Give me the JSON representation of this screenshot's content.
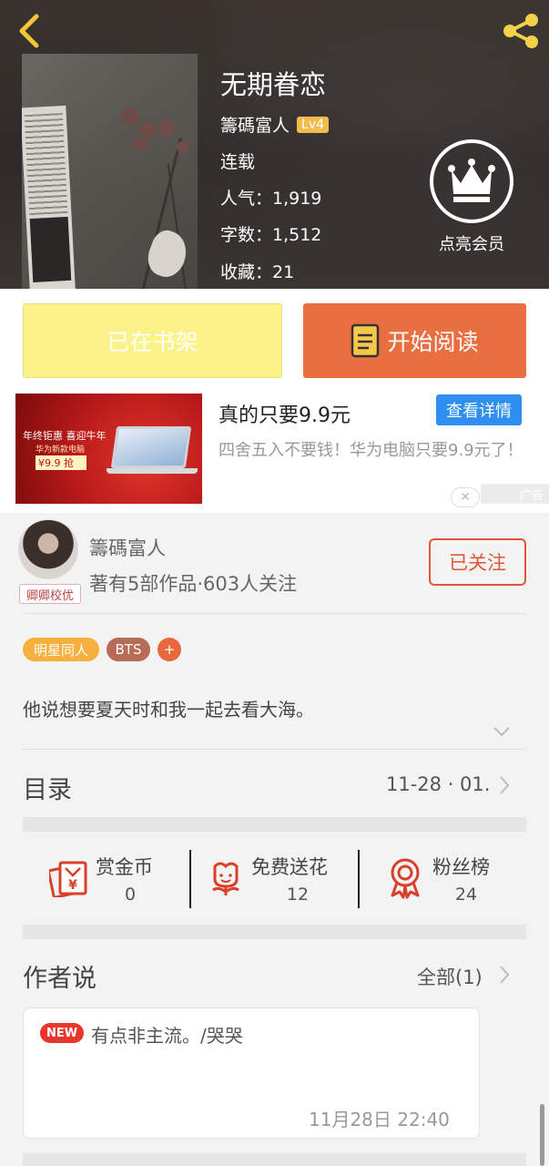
{
  "header": {
    "back_icon": "back-chevron-icon",
    "share_icon": "share-icon",
    "cover_icon": "book-cover-image"
  },
  "book": {
    "title": "无期眷恋",
    "author": "籌碼富人",
    "level": "Lv4",
    "status": "连载",
    "popularity": "人气：1,919",
    "word_count": "字数：1,512",
    "favorites": "收藏：21"
  },
  "vip": {
    "label": "点亮会员",
    "icon": "crown-icon"
  },
  "actions": {
    "shelf_label": "已在书架",
    "read_label": "开始阅读",
    "read_icon": "book-icon"
  },
  "ad": {
    "image_line1": "年终钜惠 喜迎牛年",
    "image_line2": "华为新款电脑",
    "image_price": "¥9.9 抢",
    "title": "真的只要9.9元",
    "detail_button": "查看详情",
    "description": "四舍五入不要钱！华为电脑只要9.9元了！",
    "close_symbol": "✕",
    "ad_label": "广告"
  },
  "author_info": {
    "name": "籌碼富人",
    "stats": "著有5部作品·603人关注",
    "badge": "卿卿校优",
    "follow_label": "已关注"
  },
  "tags": [
    {
      "label": "明星同人",
      "color": "#f5b03d"
    },
    {
      "label": "BTS",
      "color": "#b86b56"
    },
    {
      "label": "+",
      "color": "#e8673c"
    }
  ],
  "summary": "他说想要夏天时和我一起去看大海。",
  "toc": {
    "title": "目录",
    "date": "11-28 · 01."
  },
  "stats": {
    "reward": {
      "label": "赏金币",
      "value": "0",
      "icon": "red-envelope-icon"
    },
    "flowers": {
      "label": "免费送花",
      "value": "12",
      "icon": "flower-icon"
    },
    "fans": {
      "label": "粉丝榜",
      "value": "24",
      "icon": "medal-icon"
    }
  },
  "author_says": {
    "title": "作者说",
    "all_label": "全部(1)",
    "new_badge": "NEW",
    "note_text": "有点非主流。/哭哭",
    "note_time": "11月28日  22:40"
  },
  "colors": {
    "accent": "#e96f41",
    "icon_red": "#d8402c",
    "shelf_yellow": "#fbf38a"
  }
}
